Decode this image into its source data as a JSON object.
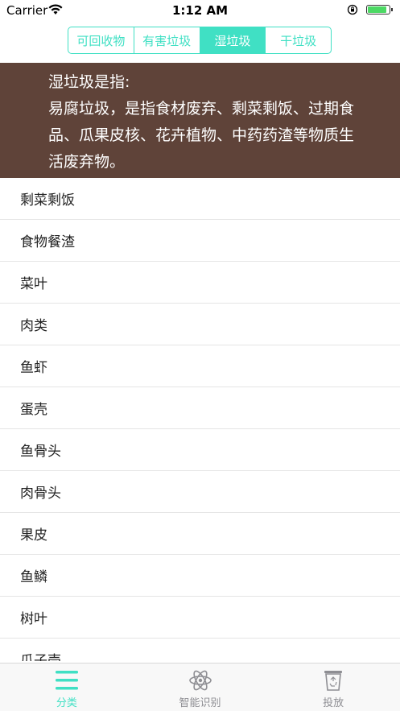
{
  "status_bar": {
    "carrier": "Carrier",
    "time": "1:12 AM",
    "battery_level": 0.9
  },
  "segments": [
    {
      "label": "可回收物",
      "active": false
    },
    {
      "label": "有害垃圾",
      "active": false
    },
    {
      "label": "湿垃圾",
      "active": true
    },
    {
      "label": "干垃圾",
      "active": false
    }
  ],
  "description": {
    "heading": "湿垃圾是指:",
    "body": "易腐垃圾，是指食材废弃、剩菜剩饭、过期食品、瓜果皮核、花卉植物、中药药渣等物质生活废弃物。"
  },
  "items": [
    "剩菜剩饭",
    "食物餐渣",
    "菜叶",
    "肉类",
    "鱼虾",
    "蛋壳",
    "鱼骨头",
    "肉骨头",
    "果皮",
    "鱼鳞",
    "树叶",
    "瓜子壳"
  ],
  "tabs": [
    {
      "label": "分类",
      "icon": "menu-icon",
      "active": true
    },
    {
      "label": "智能识别",
      "icon": "atom-icon",
      "active": false
    },
    {
      "label": "投放",
      "icon": "recycle-bin-icon",
      "active": false
    }
  ],
  "colors": {
    "accent": "#40e0c4",
    "banner": "#5f4339"
  }
}
